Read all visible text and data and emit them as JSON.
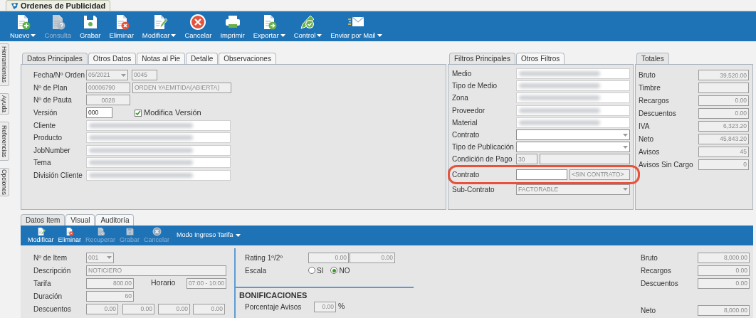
{
  "window": {
    "title": "Ordenes de Publicidad"
  },
  "toolbar": [
    {
      "kind": "new",
      "label": "Nuevo",
      "dropdown": true,
      "disabled": false
    },
    {
      "kind": "query",
      "label": "Consulta",
      "dropdown": false,
      "disabled": true
    },
    {
      "kind": "save",
      "label": "Grabar",
      "dropdown": false,
      "disabled": false
    },
    {
      "kind": "delete",
      "label": "Eliminar",
      "dropdown": false,
      "disabled": false
    },
    {
      "kind": "edit",
      "label": "Modificar",
      "dropdown": true,
      "disabled": false
    },
    {
      "kind": "cancel",
      "label": "Cancelar",
      "dropdown": false,
      "disabled": false
    },
    {
      "kind": "print",
      "label": "Imprimir",
      "dropdown": false,
      "disabled": false
    },
    {
      "kind": "export",
      "label": "Exportar",
      "dropdown": true,
      "disabled": false
    },
    {
      "kind": "control",
      "label": "Control",
      "dropdown": true,
      "disabled": false
    },
    {
      "kind": "mail",
      "label": "Enviar por Mail",
      "dropdown": true,
      "disabled": false
    }
  ],
  "side_tabs": [
    {
      "label": "Herramientas"
    },
    {
      "label": "Ayuda"
    },
    {
      "label": "Referencias"
    },
    {
      "label": "Opciones"
    }
  ],
  "main_panel": {
    "tabs": [
      {
        "label": "Datos Principales",
        "selected": true
      },
      {
        "label": "Otros Datos",
        "selected": false
      },
      {
        "label": "Notas al Pie",
        "selected": false
      },
      {
        "label": "Detalle",
        "selected": false
      },
      {
        "label": "Observaciones",
        "selected": false
      }
    ],
    "rows": [
      {
        "label": "Fecha/Nº Orden",
        "fields": [
          {
            "kind": "combo",
            "value": "05/2021",
            "editable": false
          },
          {
            "kind": "text",
            "value": "0045",
            "editable": false
          }
        ]
      },
      {
        "label": "Nº de Plan",
        "fields": [
          {
            "kind": "text",
            "value": "00006790",
            "editable": false
          },
          {
            "kind": "text",
            "value": "ORDEN YAEMITIDA(ABIERTA)",
            "editable": false
          }
        ]
      },
      {
        "label": "Nº de Pauta",
        "fields": [
          {
            "kind": "code",
            "value": "0028",
            "editable": false
          }
        ]
      },
      {
        "label": "Versión",
        "fields": [
          {
            "kind": "text",
            "value": "000",
            "editable": true
          },
          {
            "kind": "checkbox",
            "label": "Modifica Versión",
            "checked": true
          }
        ]
      },
      {
        "label": "Cliente",
        "fields": [
          {
            "kind": "blurred"
          }
        ]
      },
      {
        "label": "Producto",
        "fields": [
          {
            "kind": "blurred"
          }
        ]
      },
      {
        "label": "JobNumber",
        "fields": [
          {
            "kind": "blurred"
          }
        ]
      },
      {
        "label": "Tema",
        "fields": [
          {
            "kind": "blurred"
          }
        ]
      },
      {
        "label": "División Cliente",
        "fields": [
          {
            "kind": "blurred"
          }
        ]
      }
    ]
  },
  "filters_panel": {
    "tabs": [
      {
        "label": "Filtros Principales",
        "selected": true
      },
      {
        "label": "Otros Filtros",
        "selected": false
      }
    ],
    "rows": [
      {
        "label": "Medio",
        "highlighted": false,
        "fields": [
          {
            "kind": "blurred"
          }
        ]
      },
      {
        "label": "Tipo de Medio",
        "highlighted": false,
        "fields": [
          {
            "kind": "blurred"
          }
        ]
      },
      {
        "label": "Zona",
        "highlighted": false,
        "fields": [
          {
            "kind": "blurred"
          }
        ]
      },
      {
        "label": "Proveedor",
        "highlighted": false,
        "fields": [
          {
            "kind": "blurred"
          }
        ]
      },
      {
        "label": "Material",
        "highlighted": false,
        "fields": [
          {
            "kind": "blurred"
          }
        ]
      },
      {
        "label": "Contrato",
        "highlighted": false,
        "fields": [
          {
            "kind": "combo",
            "editable": true
          }
        ]
      },
      {
        "label": "Tipo de Publicación",
        "highlighted": false,
        "fields": [
          {
            "kind": "combo",
            "editable": true
          }
        ]
      },
      {
        "label": "Condición de Pago",
        "highlighted": false,
        "fields": [
          {
            "kind": "text",
            "value": "30",
            "editable": false
          },
          {
            "kind": "text",
            "editable": false
          }
        ]
      },
      {
        "label": "Contrato",
        "highlighted": true,
        "fields": [
          {
            "kind": "text",
            "editable": true
          },
          {
            "kind": "text",
            "value": "<SIN CONTRATO>",
            "editable": false
          }
        ]
      },
      {
        "label": "Sub-Contrato",
        "highlighted": false,
        "fields": [
          {
            "kind": "combo",
            "value": "FACTORABLE",
            "editable": false
          }
        ]
      }
    ]
  },
  "totals_panel": {
    "tabs": [
      {
        "label": "Totales",
        "selected": true
      }
    ],
    "rows": [
      {
        "label": "Bruto",
        "fields": [
          {
            "kind": "number",
            "value": "39,520.00",
            "editable": false
          }
        ]
      },
      {
        "label": "Timbre",
        "fields": [
          {
            "kind": "number",
            "editable": false
          }
        ]
      },
      {
        "label": "Recargos",
        "fields": [
          {
            "kind": "number",
            "value": "0.00",
            "editable": false
          }
        ]
      },
      {
        "label": "Descuentos",
        "fields": [
          {
            "kind": "number",
            "value": "0.00",
            "editable": false
          }
        ]
      },
      {
        "label": "IVA",
        "fields": [
          {
            "kind": "number",
            "value": "6,323.20",
            "editable": false
          }
        ]
      },
      {
        "label": "Neto",
        "fields": [
          {
            "kind": "number",
            "value": "45,843.20",
            "editable": false
          }
        ]
      },
      {
        "label": "Avisos",
        "fields": [
          {
            "kind": "number",
            "value": "45",
            "editable": false
          }
        ]
      },
      {
        "label": "Avisos Sin Cargo",
        "fields": [
          {
            "kind": "number",
            "value": "0",
            "editable": false
          }
        ]
      }
    ]
  },
  "item_panel": {
    "tabs": [
      {
        "label": "Datos Item",
        "selected": true
      },
      {
        "label": "Visual",
        "selected": false
      },
      {
        "label": "Auditoría",
        "selected": false
      }
    ],
    "toolbar": [
      {
        "kind": "edit",
        "label": "Modificar",
        "disabled": false
      },
      {
        "kind": "delete",
        "label": "Eliminar",
        "disabled": false
      },
      {
        "kind": "recover",
        "label": "Recuperar",
        "disabled": true
      },
      {
        "kind": "save",
        "label": "Grabar",
        "disabled": true
      },
      {
        "kind": "cancel",
        "label": "Cancelar",
        "disabled": true
      }
    ],
    "mode_menu": {
      "label": "Modo Ingreso Tarifa"
    },
    "rows": [
      {
        "label": "Nº de Item",
        "fields": [
          {
            "kind": "combo",
            "value": "001",
            "editable": false
          }
        ]
      },
      {
        "label": "Descripción",
        "fields": [
          {
            "kind": "text",
            "value": "NOTICIERO",
            "editable": false
          }
        ]
      },
      {
        "label": "Tarifa",
        "fields": [
          {
            "kind": "number",
            "value": "800.00",
            "editable": false
          },
          {
            "kind": "label",
            "value": "Horario"
          },
          {
            "kind": "number",
            "value": "07:00 - 10:00",
            "editable": false
          }
        ]
      },
      {
        "label": "Duración",
        "fields": [
          {
            "kind": "number",
            "value": "60",
            "editable": false
          }
        ]
      },
      {
        "label": "Descuentos",
        "fields": [
          {
            "kind": "number",
            "value": "0.00",
            "editable": false
          },
          {
            "kind": "number",
            "value": "0.00",
            "editable": false
          },
          {
            "kind": "number",
            "value": "0.00",
            "editable": false
          },
          {
            "kind": "number",
            "value": "0.00",
            "editable": false
          }
        ]
      }
    ],
    "rating_rows": [
      {
        "label": "Rating 1º/2º",
        "fields": [
          {
            "kind": "number",
            "value": "0.00",
            "editable": false
          },
          {
            "kind": "number",
            "value": "0.00",
            "editable": false
          }
        ]
      },
      {
        "label": "Escala",
        "fields": [
          {
            "kind": "radio",
            "label": "SI",
            "selected": false
          },
          {
            "kind": "radio",
            "label": "NO",
            "selected": true
          }
        ]
      }
    ],
    "bonificaciones": {
      "title": "BONIFICACIONES",
      "rows": [
        {
          "label": "Porcentaje Avisos",
          "fields": [
            {
              "kind": "number",
              "value": "0.00",
              "editable": false
            },
            {
              "kind": "label",
              "value": "%"
            }
          ]
        }
      ]
    },
    "totals": [
      {
        "label": "Bruto",
        "fields": [
          {
            "kind": "number",
            "value": "8,000.00",
            "editable": false
          }
        ]
      },
      {
        "label": "Recargos",
        "fields": [
          {
            "kind": "number",
            "value": "0.00",
            "editable": false
          }
        ]
      },
      {
        "label": "Descuentos",
        "fields": [
          {
            "kind": "number",
            "value": "0.00",
            "editable": false
          }
        ]
      },
      {
        "label": "Neto",
        "fields": [
          {
            "kind": "number",
            "value": "8,000.00",
            "editable": false
          }
        ]
      }
    ]
  }
}
